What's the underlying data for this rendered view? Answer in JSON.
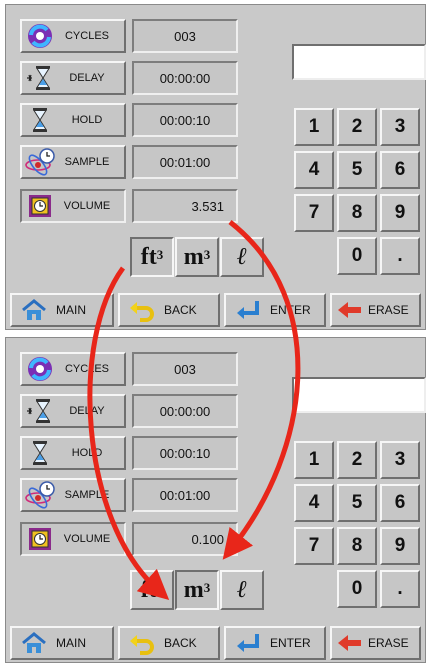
{
  "panels": [
    {
      "rows": [
        {
          "label": "CYCLES",
          "icon": "cycles-icon",
          "value": "003"
        },
        {
          "label": "DELAY",
          "icon": "hourglass-delay-icon",
          "value": "00:00:00"
        },
        {
          "label": "HOLD",
          "icon": "hourglass-icon",
          "value": "00:00:10"
        },
        {
          "label": "SAMPLE",
          "icon": "sample-clock-icon",
          "value": "00:01:00"
        },
        {
          "label": "VOLUME",
          "icon": "volume-box-icon",
          "value": "3.531"
        }
      ],
      "display_value": "",
      "keys": [
        "1",
        "2",
        "3",
        "4",
        "5",
        "6",
        "7",
        "8",
        "9",
        "0",
        "."
      ],
      "units": {
        "ft": "ft",
        "m": "m",
        "exp": "3",
        "liter": "ℓ",
        "selected": "ft3"
      },
      "bottom": [
        {
          "label": "MAIN",
          "icon": "home-icon"
        },
        {
          "label": "BACK",
          "icon": "back-arrow-icon"
        },
        {
          "label": "ENTER",
          "icon": "enter-arrow-icon"
        },
        {
          "label": "ERASE",
          "icon": "erase-arrow-icon"
        }
      ]
    },
    {
      "rows": [
        {
          "label": "CYCLES",
          "icon": "cycles-icon",
          "value": "003"
        },
        {
          "label": "DELAY",
          "icon": "hourglass-delay-icon",
          "value": "00:00:00"
        },
        {
          "label": "HOLD",
          "icon": "hourglass-icon",
          "value": "00:00:10"
        },
        {
          "label": "SAMPLE",
          "icon": "sample-clock-icon",
          "value": "00:01:00"
        },
        {
          "label": "VOLUME",
          "icon": "volume-box-icon",
          "value": "0.100"
        }
      ],
      "display_value": "",
      "keys": [
        "1",
        "2",
        "3",
        "4",
        "5",
        "6",
        "7",
        "8",
        "9",
        "0",
        "."
      ],
      "units": {
        "ft": "ft",
        "m": "m",
        "exp": "3",
        "liter": "ℓ",
        "selected": "m3"
      },
      "bottom": [
        {
          "label": "MAIN",
          "icon": "home-icon"
        },
        {
          "label": "BACK",
          "icon": "back-arrow-icon"
        },
        {
          "label": "ENTER",
          "icon": "enter-arrow-icon"
        },
        {
          "label": "ERASE",
          "icon": "erase-arrow-icon"
        }
      ]
    }
  ],
  "colors": {
    "panel": "#c9c9c9",
    "annotation": "#e8261a",
    "home": "#3a8fd8",
    "back": "#f2d21a",
    "enter": "#2a7fd0",
    "erase": "#e03a2a"
  }
}
